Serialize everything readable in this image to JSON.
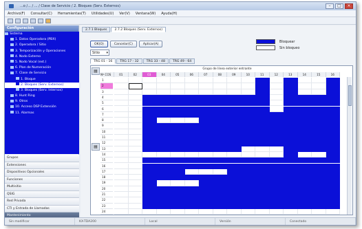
{
  "window": {
    "title": "...o /... / ... / Clase de Servicio / 2. Bloques (Serv. Externos)"
  },
  "menu": [
    "Archivo(F)",
    "Consultar(C)",
    "Herramientas(T)",
    "Utilidades(U)",
    "Ver(V)",
    "Ventana(W)",
    "Ayuda(H)"
  ],
  "left_panel": {
    "header": "Configuración",
    "tree_header": "Sistema",
    "tree_items": [
      {
        "label": "1. Datos Operadora (PBX)",
        "selected": false
      },
      {
        "label": "2. Operadora / Sitio",
        "selected": false
      },
      {
        "label": "3. Temporización y Operaciones",
        "selected": false
      },
      {
        "label": "4. Nodo Externo",
        "selected": false
      },
      {
        "label": "5. Nodo Vocal (ext.)",
        "selected": false
      },
      {
        "label": "6. Plan de Numeración",
        "selected": false
      },
      {
        "label": "7. Clase de Servicio",
        "selected": false
      },
      {
        "label": "1. Bloque",
        "selected": false
      },
      {
        "label": "2. Bloques (Serv. Externos)",
        "selected": true
      },
      {
        "label": "3. Bloques (Serv. Internos)",
        "selected": false
      },
      {
        "label": "8. Hunt Ring",
        "selected": false
      },
      {
        "label": "9. Otros",
        "selected": false
      },
      {
        "label": "10. Acceso DSP Extensión",
        "selected": false
      },
      {
        "label": "11. Alarmas",
        "selected": false
      }
    ],
    "sections": [
      {
        "label": "Grupos",
        "dark": false
      },
      {
        "label": "Extensiones",
        "dark": false
      },
      {
        "label": "Dispositivos Opcionales",
        "dark": false
      },
      {
        "label": "Funciones",
        "dark": false
      },
      {
        "label": "Multisitio",
        "dark": false
      },
      {
        "label": "QSIG",
        "dark": false
      },
      {
        "label": "Red Privada",
        "dark": false
      },
      {
        "label": "CTI y Entrada de Llamadas",
        "dark": false
      },
      {
        "label": "Mantenimiento",
        "dark": true
      }
    ]
  },
  "main": {
    "tabs": [
      {
        "label": "2.7.1 Bloques",
        "active": false
      },
      {
        "label": "2.7.2 Bloques (Serv. Externos)",
        "active": true
      }
    ],
    "buttons": {
      "ok": "OK(O)",
      "cancel": "Cancelar(C)",
      "apply": "Aplicar(A)"
    },
    "legend": [
      {
        "label": "Bloquear",
        "color": "#0b10d8"
      },
      {
        "label": "Sin bloqueo",
        "color": "#ffffff"
      }
    ],
    "dropdown_value": "Sitio",
    "subtabs": [
      {
        "label": "TRG 01 - 16",
        "active": true
      },
      {
        "label": "TRG 17 - 32",
        "active": false
      },
      {
        "label": "TRG 33 - 48",
        "active": false
      },
      {
        "label": "TRG 49 - 64",
        "active": false
      }
    ],
    "grid": {
      "corner_label": "Nº COS",
      "group_header": "Grupo de línea exterior entrante",
      "columns": [
        "01",
        "02",
        "03",
        "04",
        "05",
        "06",
        "07",
        "08",
        "09",
        "10",
        "11",
        "12",
        "13",
        "14",
        "15",
        "16"
      ],
      "highlight_col": 2,
      "pink_row": 1,
      "focus_cell": [
        1,
        1
      ],
      "rows": [
        {
          "label": "1",
          "cells": [
            0,
            0,
            0,
            0,
            0,
            0,
            0,
            0,
            0,
            0,
            1,
            0,
            1,
            0,
            0,
            1
          ]
        },
        {
          "label": "2",
          "cells": [
            0,
            0,
            0,
            0,
            0,
            0,
            0,
            0,
            0,
            0,
            1,
            0,
            1,
            0,
            0,
            1
          ]
        },
        {
          "label": "3",
          "cells": [
            0,
            0,
            0,
            0,
            0,
            0,
            0,
            0,
            0,
            0,
            1,
            0,
            1,
            0,
            0,
            1
          ]
        },
        {
          "label": "4",
          "cells": [
            0,
            0,
            1,
            1,
            1,
            1,
            1,
            1,
            1,
            1,
            1,
            0,
            1,
            1,
            1,
            1
          ]
        },
        {
          "label": "5",
          "cells": [
            0,
            0,
            1,
            1,
            1,
            1,
            1,
            1,
            1,
            1,
            1,
            0,
            1,
            1,
            1,
            1
          ]
        },
        {
          "label": "6",
          "cells": [
            0,
            0,
            1,
            1,
            1,
            1,
            1,
            1,
            1,
            1,
            1,
            0,
            1,
            1,
            1,
            1
          ]
        },
        {
          "label": "7",
          "cells": [
            0,
            0,
            1,
            1,
            1,
            1,
            1,
            1,
            1,
            1,
            1,
            1,
            1,
            1,
            1,
            1
          ]
        },
        {
          "label": "8",
          "cells": [
            0,
            0,
            1,
            0,
            0,
            0,
            1,
            1,
            1,
            1,
            1,
            1,
            1,
            1,
            1,
            1
          ]
        },
        {
          "label": "9",
          "cells": [
            0,
            0,
            1,
            1,
            1,
            1,
            1,
            1,
            1,
            1,
            1,
            1,
            1,
            1,
            1,
            1
          ]
        },
        {
          "label": "10",
          "cells": [
            0,
            0,
            1,
            1,
            1,
            1,
            1,
            1,
            1,
            1,
            1,
            1,
            1,
            1,
            1,
            1
          ]
        },
        {
          "label": "11",
          "cells": [
            0,
            0,
            1,
            1,
            1,
            1,
            1,
            1,
            1,
            1,
            1,
            1,
            1,
            1,
            1,
            1
          ]
        },
        {
          "label": "12",
          "cells": [
            0,
            0,
            1,
            1,
            1,
            1,
            1,
            1,
            1,
            1,
            1,
            1,
            1,
            1,
            1,
            1
          ]
        },
        {
          "label": "13",
          "cells": [
            0,
            0,
            1,
            1,
            1,
            1,
            1,
            1,
            1,
            0,
            0,
            0,
            1,
            1,
            1,
            1
          ]
        },
        {
          "label": "14",
          "cells": [
            0,
            0,
            0,
            0,
            0,
            0,
            0,
            0,
            0,
            0,
            0,
            0,
            1,
            0,
            0,
            1
          ]
        },
        {
          "label": "15",
          "cells": [
            0,
            0,
            1,
            1,
            1,
            1,
            1,
            1,
            1,
            1,
            1,
            1,
            1,
            1,
            1,
            1
          ]
        },
        {
          "label": "16",
          "cells": [
            0,
            0,
            1,
            1,
            1,
            1,
            1,
            1,
            1,
            1,
            1,
            1,
            1,
            1,
            1,
            1
          ]
        },
        {
          "label": "17",
          "cells": [
            0,
            0,
            1,
            1,
            1,
            0,
            0,
            0,
            1,
            1,
            1,
            1,
            1,
            1,
            1,
            1
          ]
        },
        {
          "label": "18",
          "cells": [
            0,
            0,
            1,
            1,
            1,
            1,
            1,
            1,
            1,
            1,
            1,
            1,
            1,
            1,
            1,
            1
          ]
        },
        {
          "label": "19",
          "cells": [
            0,
            0,
            1,
            0,
            0,
            0,
            1,
            1,
            1,
            1,
            1,
            1,
            1,
            1,
            1,
            1
          ]
        },
        {
          "label": "20",
          "cells": [
            0,
            0,
            1,
            1,
            1,
            1,
            1,
            1,
            1,
            1,
            1,
            1,
            1,
            1,
            1,
            1
          ]
        },
        {
          "label": "21",
          "cells": [
            0,
            0,
            1,
            1,
            1,
            1,
            1,
            1,
            1,
            1,
            1,
            1,
            1,
            1,
            1,
            1
          ]
        },
        {
          "label": "22",
          "cells": [
            0,
            0,
            1,
            1,
            1,
            1,
            1,
            1,
            1,
            1,
            1,
            1,
            1,
            1,
            1,
            1
          ]
        },
        {
          "label": "23",
          "cells": [
            0,
            0,
            1,
            1,
            1,
            1,
            1,
            1,
            1,
            1,
            1,
            1,
            1,
            1,
            1,
            1
          ]
        },
        {
          "label": "24",
          "cells": [
            0,
            0,
            0,
            0,
            0,
            0,
            0,
            0,
            0,
            0,
            0,
            0,
            0,
            0,
            0,
            0
          ]
        }
      ]
    }
  },
  "status": [
    "Sin modificar",
    "KX-TDA200",
    "Local",
    "Versión",
    "Conectado"
  ]
}
